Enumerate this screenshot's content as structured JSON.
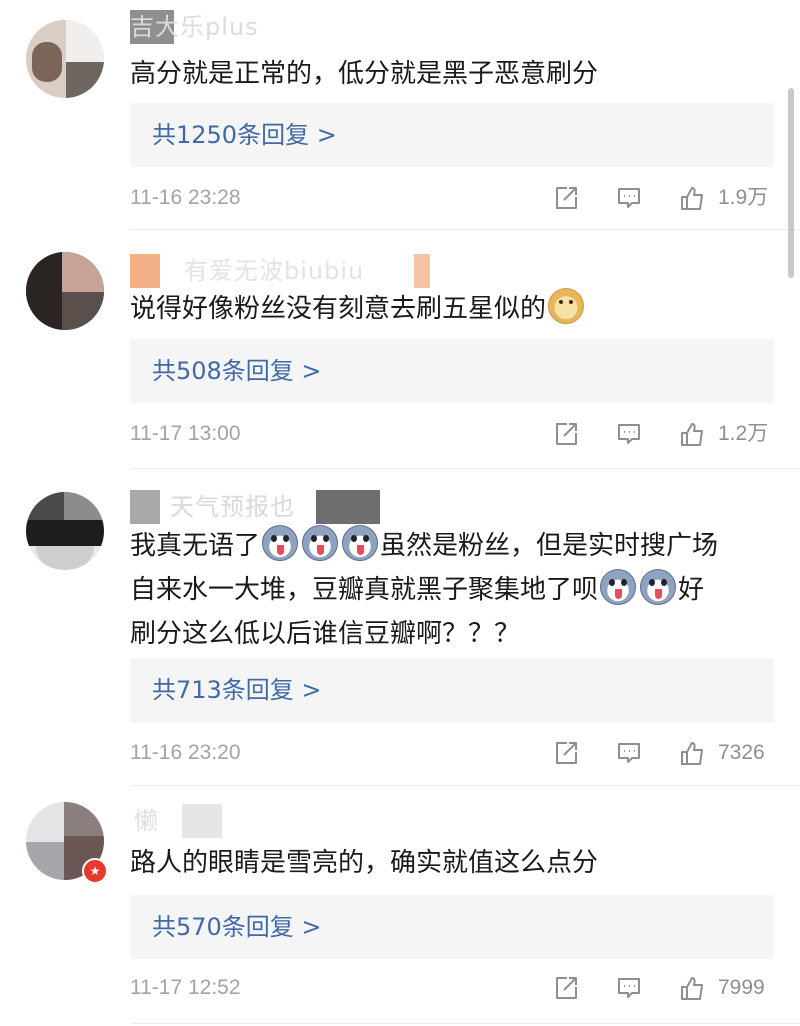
{
  "comments": [
    {
      "username": "吉大乐plus",
      "text_lines": [
        [
          {
            "t": "高分就是正常的，低分就是黑子恶意刷分"
          }
        ]
      ],
      "reply_label": "共1250条回复 >",
      "time": "11-16 23:28",
      "likes": "1.9万"
    },
    {
      "username": "有爱无波biubiu",
      "text_lines": [
        [
          {
            "t": "说得好像粉丝没有刻意去刷五星似的"
          },
          {
            "e": "doge"
          }
        ]
      ],
      "reply_label": "共508条回复 >",
      "time": "11-17 13:00",
      "likes": "1.2万"
    },
    {
      "username": "天气预报也",
      "text_lines": [
        [
          {
            "t": "我真无语了"
          },
          {
            "e": "husky"
          },
          {
            "e": "husky"
          },
          {
            "e": "husky"
          },
          {
            "t": "虽然是粉丝，但是实时搜广场"
          }
        ],
        [
          {
            "t": "自来水一大堆，豆瓣真就黑子聚集地了呗"
          },
          {
            "e": "husky"
          },
          {
            "e": "husky"
          },
          {
            "t": "好"
          }
        ],
        [
          {
            "t": "刷分这么低以后谁信豆瓣啊？？？"
          }
        ]
      ],
      "reply_label": "共713条回复 >",
      "time": "11-16 23:20",
      "likes": "7326"
    },
    {
      "username": "懒",
      "text_lines": [
        [
          {
            "t": "路人的眼睛是雪亮的，确实就值这么点分"
          }
        ]
      ],
      "reply_label": "共570条回复 >",
      "time": "11-17 12:52",
      "likes": "7999"
    }
  ],
  "icons": {
    "share": "share-icon",
    "comment": "comment-icon",
    "like": "thumbs-up-icon",
    "emoji_doge": "doge-emoji",
    "emoji_husky": "husky-emoji"
  },
  "colors": {
    "reply_link": "#3f6aa6",
    "reply_bg": "#f5f5f5",
    "meta_text": "#a3a3a3",
    "verified_badge": "#e8372b"
  }
}
